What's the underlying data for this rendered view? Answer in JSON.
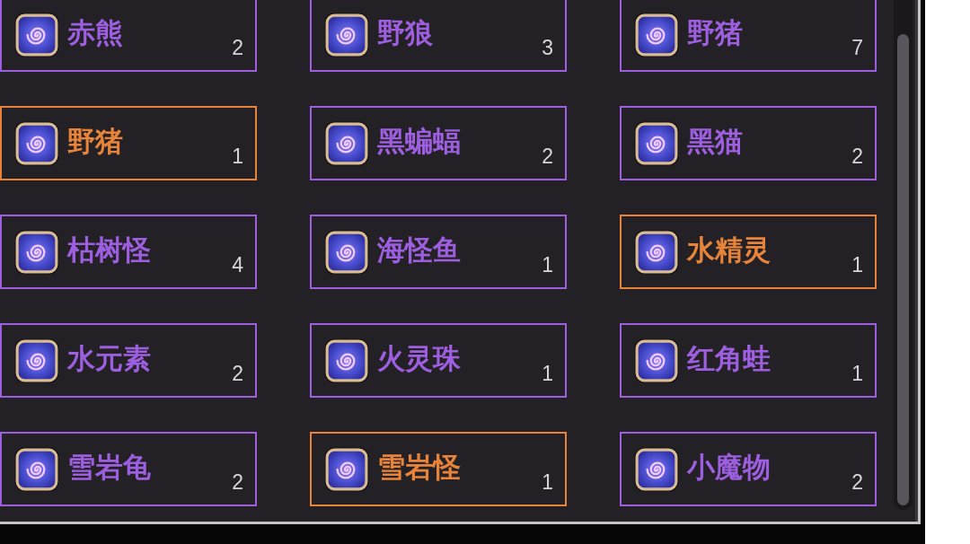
{
  "items": [
    {
      "name": "赤熊",
      "count": "2",
      "color": "#9d5fe0"
    },
    {
      "name": "野狼",
      "count": "3",
      "color": "#9d5fe0"
    },
    {
      "name": "野猪",
      "count": "7",
      "color": "#9d5fe0"
    },
    {
      "name": "野猪",
      "count": "1",
      "color": "#e8843a"
    },
    {
      "name": "黑蝙蝠",
      "count": "2",
      "color": "#9d5fe0"
    },
    {
      "name": "黑猫",
      "count": "2",
      "color": "#9d5fe0"
    },
    {
      "name": "枯树怪",
      "count": "4",
      "color": "#9d5fe0"
    },
    {
      "name": "海怪鱼",
      "count": "1",
      "color": "#9d5fe0"
    },
    {
      "name": "水精灵",
      "count": "1",
      "color": "#e8843a"
    },
    {
      "name": "水元素",
      "count": "2",
      "color": "#9d5fe0"
    },
    {
      "name": "火灵珠",
      "count": "1",
      "color": "#9d5fe0"
    },
    {
      "name": "红角蛙",
      "count": "1",
      "color": "#9d5fe0"
    },
    {
      "name": "雪岩龟",
      "count": "2",
      "color": "#9d5fe0"
    },
    {
      "name": "雪岩怪",
      "count": "1",
      "color": "#e8843a"
    },
    {
      "name": "小魔物",
      "count": "2",
      "color": "#9d5fe0"
    }
  ]
}
